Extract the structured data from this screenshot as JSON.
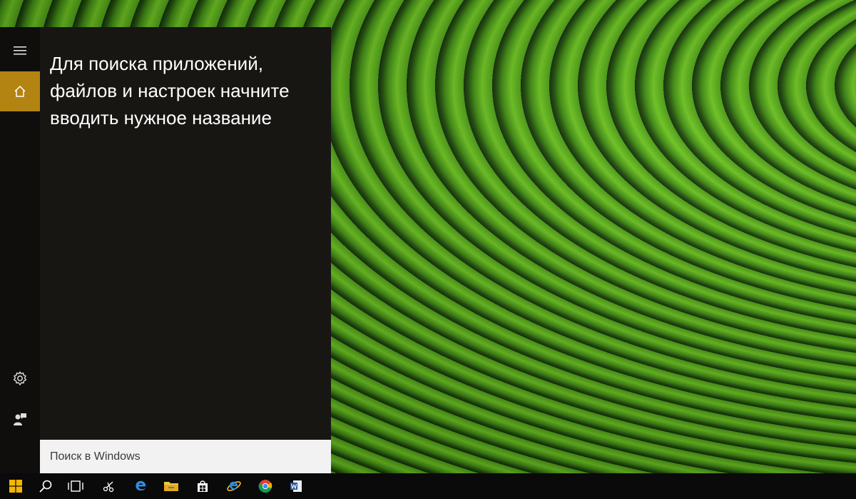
{
  "start_panel": {
    "hint_text": "Для поиска приложений, файлов и настроек начните вводить нужное название",
    "search": {
      "placeholder": "Поиск в Windows"
    },
    "rail": [
      {
        "id": "menu",
        "icon": "hamburger-icon"
      },
      {
        "id": "home",
        "icon": "home-icon",
        "selected": true
      },
      {
        "id": "settings",
        "icon": "gear-icon"
      },
      {
        "id": "feedback",
        "icon": "feedback-icon"
      }
    ],
    "accent_color": "#b38411"
  },
  "taskbar": {
    "items": [
      {
        "id": "start",
        "icon": "windows-logo-icon"
      },
      {
        "id": "search",
        "icon": "search-icon"
      },
      {
        "id": "task-view",
        "icon": "task-view-icon"
      },
      {
        "id": "snipping-tool",
        "icon": "scissors-icon"
      },
      {
        "id": "edge",
        "icon": "edge-icon"
      },
      {
        "id": "file-explorer",
        "icon": "folder-icon"
      },
      {
        "id": "store",
        "icon": "store-icon"
      },
      {
        "id": "internet-explorer",
        "icon": "ie-icon"
      },
      {
        "id": "chrome",
        "icon": "chrome-icon"
      },
      {
        "id": "word",
        "icon": "word-icon"
      }
    ]
  }
}
